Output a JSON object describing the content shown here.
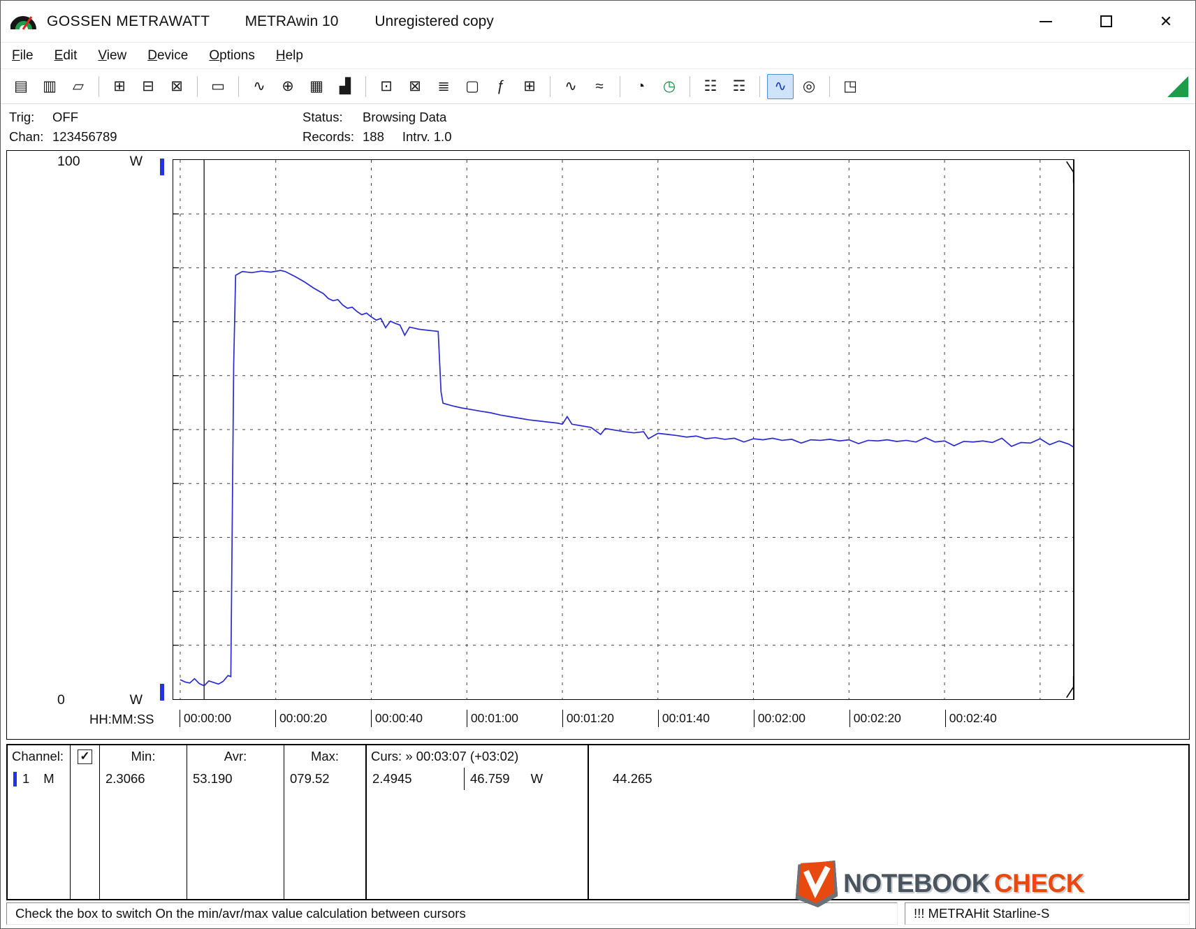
{
  "window": {
    "app_name": "GOSSEN METRAWATT",
    "product": "METRAwin 10",
    "license": "Unregistered copy",
    "controls": {
      "minimize": "minimize",
      "maximize": "maximize",
      "close": "✕"
    }
  },
  "menu": {
    "items": [
      "File",
      "Edit",
      "View",
      "Device",
      "Options",
      "Help"
    ]
  },
  "toolbar": {
    "groups": [
      [
        {
          "name": "save-icon",
          "glyph": "▤"
        },
        {
          "name": "save-as-icon",
          "glyph": "▥"
        },
        {
          "name": "open-file-icon",
          "glyph": "▱"
        }
      ],
      [
        {
          "name": "export-to-device-icon",
          "glyph": "⊞"
        },
        {
          "name": "read-device-memory-icon",
          "glyph": "⊟"
        },
        {
          "name": "device-transfer-icon",
          "glyph": "⊠"
        }
      ],
      [
        {
          "name": "memory-card-icon",
          "glyph": "▭"
        }
      ],
      [
        {
          "name": "trend-graph-icon",
          "glyph": "∿"
        },
        {
          "name": "crosshair-icon",
          "glyph": "⊕"
        },
        {
          "name": "data-table-icon",
          "glyph": "▦"
        },
        {
          "name": "histogram-icon",
          "glyph": "▟"
        }
      ],
      [
        {
          "name": "monitor-export-icon",
          "glyph": "⊡"
        },
        {
          "name": "monitor-config-icon",
          "glyph": "⊠"
        },
        {
          "name": "channel-mixer-icon",
          "glyph": "≣"
        },
        {
          "name": "display-monitor-icon",
          "glyph": "▢"
        },
        {
          "name": "formula-icon",
          "glyph": "ƒ"
        },
        {
          "name": "device-display-icon",
          "glyph": "⊞"
        }
      ],
      [
        {
          "name": "waveform-icon",
          "glyph": "∿"
        },
        {
          "name": "envelope-waveform-icon",
          "glyph": "≈"
        }
      ],
      [
        {
          "name": "duty-cycle-clock-icon",
          "glyph": "◔"
        },
        {
          "name": "timer-clock-icon",
          "glyph": "◷",
          "color": "#178a3c"
        }
      ],
      [
        {
          "name": "print-icon",
          "glyph": "☷"
        },
        {
          "name": "print-setup-icon",
          "glyph": "☶"
        }
      ],
      [
        {
          "name": "zoom-signal-icon",
          "glyph": "∿",
          "active": true
        },
        {
          "name": "zoom-magnifier-icon",
          "glyph": "◎"
        }
      ],
      [
        {
          "name": "annotation-icon",
          "glyph": "◳"
        }
      ]
    ]
  },
  "info": {
    "trig_label": "Trig:",
    "trig_value": "OFF",
    "chan_label": "Chan:",
    "chan_value": "123456789",
    "status_label": "Status:",
    "status_value": "Browsing Data",
    "records_label": "Records:",
    "records_value": "188",
    "intrv_label": "Intrv.",
    "intrv_value": "1.0"
  },
  "chart": {
    "y_max_label": "100",
    "y_max_unit": "W",
    "y_min_label": "0",
    "y_min_unit": "W",
    "x_axis_title": "HH:MM:SS"
  },
  "chart_data": {
    "type": "line",
    "title": "",
    "xlabel": "HH:MM:SS",
    "ylabel": "W",
    "ylim": [
      0,
      100
    ],
    "x_window_s": [
      -1.5,
      187
    ],
    "grid": "dashed",
    "grid_x_s": [
      0,
      20,
      40,
      60,
      80,
      100,
      120,
      140,
      160,
      180
    ],
    "grid_y_w": [
      10,
      20,
      30,
      40,
      50,
      60,
      70,
      80,
      90
    ],
    "x_ticks": [
      {
        "t": 0,
        "label": "00:00:00"
      },
      {
        "t": 20,
        "label": "00:00:20"
      },
      {
        "t": 40,
        "label": "00:00:40"
      },
      {
        "t": 60,
        "label": "00:01:00"
      },
      {
        "t": 80,
        "label": "00:01:20"
      },
      {
        "t": 100,
        "label": "00:01:40"
      },
      {
        "t": 120,
        "label": "00:02:00"
      },
      {
        "t": 140,
        "label": "00:02:20"
      },
      {
        "t": 160,
        "label": "00:02:40"
      }
    ],
    "cursors": [
      {
        "name": "cursor-1",
        "t_s": 5,
        "value_w": 2.4945
      },
      {
        "name": "cursor-2",
        "t_s": 187,
        "time": "00:03:07",
        "value_w": 46.759
      }
    ],
    "stats": {
      "min_w": 2.3066,
      "avr_w": 53.19,
      "max_w": 79.52,
      "records": 188,
      "interval_s": 1.0
    },
    "series": [
      {
        "name": "channel-1-power",
        "color": "#2a2ad2",
        "points": [
          [
            0,
            3.6
          ],
          [
            1,
            3.2
          ],
          [
            2,
            3.0
          ],
          [
            3,
            3.8
          ],
          [
            4,
            2.9
          ],
          [
            5,
            2.49
          ],
          [
            6,
            3.4
          ],
          [
            7,
            3.1
          ],
          [
            8,
            2.8
          ],
          [
            9,
            3.3
          ],
          [
            10,
            4.4
          ],
          [
            10.6,
            4.2
          ],
          [
            11.2,
            62
          ],
          [
            11.6,
            78.6
          ],
          [
            13,
            79.3
          ],
          [
            15,
            79.1
          ],
          [
            17,
            79.4
          ],
          [
            19,
            79.2
          ],
          [
            21,
            79.52
          ],
          [
            22,
            79.3
          ],
          [
            24,
            78.4
          ],
          [
            26,
            77.4
          ],
          [
            28,
            76.2
          ],
          [
            30,
            75.2
          ],
          [
            31,
            74.3
          ],
          [
            32,
            73.9
          ],
          [
            33,
            74.1
          ],
          [
            34,
            73.1
          ],
          [
            35,
            72.5
          ],
          [
            36,
            72.7
          ],
          [
            37,
            71.9
          ],
          [
            38,
            71.3
          ],
          [
            39,
            71.6
          ],
          [
            40,
            70.9
          ],
          [
            41,
            70.3
          ],
          [
            42,
            70.6
          ],
          [
            43,
            68.9
          ],
          [
            44,
            70.1
          ],
          [
            45,
            69.7
          ],
          [
            46,
            69.4
          ],
          [
            47,
            67.5
          ],
          [
            48,
            69.0
          ],
          [
            49,
            68.8
          ],
          [
            50,
            68.6
          ],
          [
            51,
            68.5
          ],
          [
            52,
            68.4
          ],
          [
            53,
            68.3
          ],
          [
            54,
            68.2
          ],
          [
            54.6,
            57.0
          ],
          [
            55,
            54.9
          ],
          [
            57,
            54.4
          ],
          [
            59,
            54.0
          ],
          [
            61,
            53.7
          ],
          [
            63,
            53.4
          ],
          [
            65,
            53.1
          ],
          [
            67,
            52.7
          ],
          [
            69,
            52.4
          ],
          [
            71,
            52.1
          ],
          [
            73,
            51.8
          ],
          [
            75,
            51.6
          ],
          [
            77,
            51.4
          ],
          [
            79,
            51.2
          ],
          [
            80,
            51.0
          ],
          [
            81,
            52.4
          ],
          [
            82,
            51.0
          ],
          [
            84,
            50.7
          ],
          [
            86,
            50.4
          ],
          [
            88,
            49.1
          ],
          [
            89,
            50.2
          ],
          [
            91,
            49.9
          ],
          [
            93,
            49.6
          ],
          [
            95,
            49.4
          ],
          [
            97,
            49.6
          ],
          [
            98,
            48.3
          ],
          [
            100,
            49.3
          ],
          [
            102,
            49.1
          ],
          [
            104,
            48.9
          ],
          [
            106,
            48.6
          ],
          [
            108,
            48.8
          ],
          [
            110,
            48.3
          ],
          [
            112,
            48.5
          ],
          [
            114,
            48.2
          ],
          [
            116,
            48.4
          ],
          [
            118,
            47.7
          ],
          [
            120,
            48.3
          ],
          [
            122,
            48.1
          ],
          [
            124,
            48.4
          ],
          [
            126,
            48.0
          ],
          [
            128,
            48.2
          ],
          [
            130,
            47.5
          ],
          [
            132,
            48.1
          ],
          [
            134,
            48.0
          ],
          [
            136,
            48.2
          ],
          [
            138,
            47.9
          ],
          [
            140,
            48.1
          ],
          [
            142,
            47.4
          ],
          [
            144,
            48.0
          ],
          [
            146,
            47.9
          ],
          [
            148,
            48.1
          ],
          [
            150,
            47.8
          ],
          [
            152,
            48.0
          ],
          [
            154,
            47.7
          ],
          [
            156,
            48.5
          ],
          [
            158,
            47.7
          ],
          [
            160,
            47.9
          ],
          [
            162,
            47.0
          ],
          [
            164,
            47.8
          ],
          [
            166,
            47.7
          ],
          [
            168,
            47.9
          ],
          [
            170,
            47.6
          ],
          [
            172,
            48.4
          ],
          [
            174,
            46.9
          ],
          [
            176,
            47.6
          ],
          [
            178,
            47.5
          ],
          [
            180,
            48.3
          ],
          [
            182,
            47.2
          ],
          [
            184,
            47.9
          ],
          [
            186,
            47.3
          ],
          [
            187,
            46.76
          ]
        ]
      }
    ]
  },
  "table": {
    "channel_header": "Channel:",
    "check_glyph": "✓",
    "min_header": "Min:",
    "avr_header": "Avr:",
    "max_header": "Max:",
    "curs_header": "Curs: » 00:03:07 (+03:02)",
    "row": {
      "channel": "1",
      "mode": "M",
      "min": "2.3066",
      "avr": "53.190",
      "max": "079.52",
      "curs1": "2.4945",
      "curs2": "46.759",
      "curs2_unit": "W",
      "delta": "44.265"
    }
  },
  "statusbar": {
    "message": "Check the box to switch On the min/avr/max value calculation between cursors",
    "device": "!!! METRAHit Starline-S"
  },
  "watermark": {
    "text_dark": "NOTEBOOK",
    "text_accent": "CHECK"
  }
}
